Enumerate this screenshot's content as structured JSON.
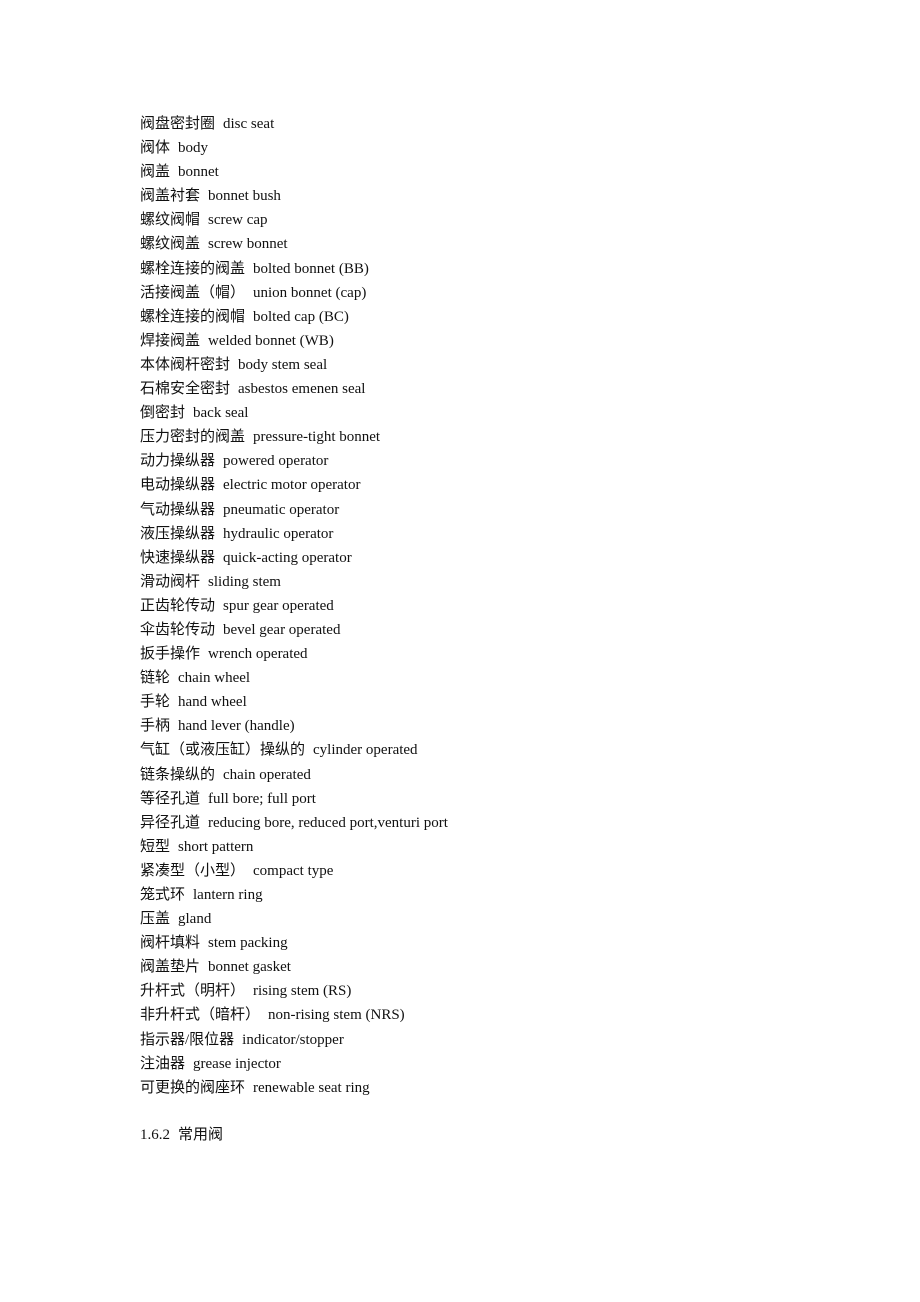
{
  "document": {
    "terms": [
      {
        "zh": "阀盘密封圈",
        "en": "disc seat"
      },
      {
        "zh": "阀体",
        "en": "body"
      },
      {
        "zh": "阀盖",
        "en": "bonnet"
      },
      {
        "zh": "阀盖衬套",
        "en": "bonnet bush"
      },
      {
        "zh": "螺纹阀帽",
        "en": "screw cap"
      },
      {
        "zh": "螺纹阀盖",
        "en": "screw bonnet"
      },
      {
        "zh": "螺栓连接的阀盖",
        "en": "bolted bonnet (BB)"
      },
      {
        "zh": "活接阀盖（帽）",
        "en": "union bonnet (cap)"
      },
      {
        "zh": "螺栓连接的阀帽",
        "en": "bolted cap (BC)"
      },
      {
        "zh": "焊接阀盖",
        "en": "welded bonnet (WB)"
      },
      {
        "zh": "本体阀杆密封",
        "en": "body stem seal"
      },
      {
        "zh": "石棉安全密封",
        "en": "asbestos emenen seal"
      },
      {
        "zh": "倒密封",
        "en": "back seal"
      },
      {
        "zh": "压力密封的阀盖",
        "en": "pressure-tight bonnet"
      },
      {
        "zh": "动力操纵器",
        "en": "powered operator"
      },
      {
        "zh": "电动操纵器",
        "en": "electric motor operator"
      },
      {
        "zh": "气动操纵器",
        "en": "pneumatic operator"
      },
      {
        "zh": "液压操纵器",
        "en": "hydraulic operator"
      },
      {
        "zh": "快速操纵器",
        "en": "quick-acting operator"
      },
      {
        "zh": "滑动阀杆",
        "en": "sliding stem"
      },
      {
        "zh": "正齿轮传动",
        "en": "spur gear operated"
      },
      {
        "zh": "伞齿轮传动",
        "en": "bevel gear operated"
      },
      {
        "zh": "扳手操作",
        "en": "wrench operated"
      },
      {
        "zh": "链轮",
        "en": "chain wheel"
      },
      {
        "zh": "手轮",
        "en": "hand wheel"
      },
      {
        "zh": "手柄",
        "en": "hand lever (handle)"
      },
      {
        "zh": "气缸（或液压缸）操纵的",
        "en": "cylinder operated"
      },
      {
        "zh": "链条操纵的",
        "en": "chain operated"
      },
      {
        "zh": "等径孔道",
        "en": "full bore; full port"
      },
      {
        "zh": "异径孔道",
        "en": "reducing bore, reduced port,venturi port"
      },
      {
        "zh": "短型",
        "en": "short pattern"
      },
      {
        "zh": "紧凑型（小型）",
        "en": "compact type"
      },
      {
        "zh": "笼式环",
        "en": "lantern ring"
      },
      {
        "zh": "压盖",
        "en": "gland"
      },
      {
        "zh": "阀杆填料",
        "en": "stem packing"
      },
      {
        "zh": "阀盖垫片",
        "en": "bonnet gasket"
      },
      {
        "zh": "升杆式（明杆）",
        "en": "rising stem (RS)"
      },
      {
        "zh": "非升杆式（暗杆）",
        "en": "non-rising stem (NRS)"
      },
      {
        "zh": "指示器/限位器",
        "en": "indicator/stopper"
      },
      {
        "zh": "注油器",
        "en": "grease injector"
      },
      {
        "zh": "可更换的阀座环",
        "en": "renewable seat ring"
      }
    ],
    "section_heading": {
      "number": "1.6.2",
      "title": "常用阀"
    }
  }
}
